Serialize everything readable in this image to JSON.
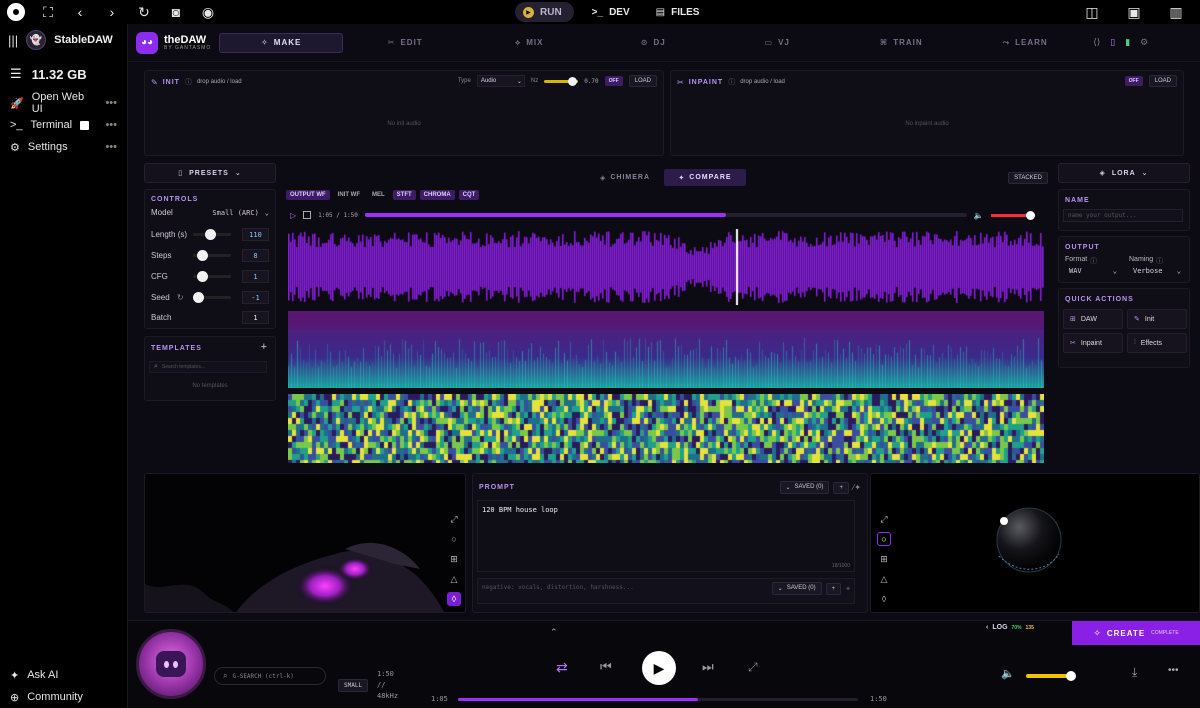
{
  "topbar": {
    "run": "RUN",
    "dev": "DEV",
    "files": "FILES"
  },
  "sidebar": {
    "title": "StableDAW",
    "disk": "11.32 GB",
    "items": [
      {
        "label": "Open Web UI",
        "icon": "rocket-icon"
      },
      {
        "label": "Terminal",
        "icon": "terminal-icon"
      },
      {
        "label": "Settings",
        "icon": "gear-icon"
      }
    ],
    "ask": "Ask AI",
    "community": "Community"
  },
  "app": {
    "logo": "theDAW",
    "logo_sub": "BY GANTASMO",
    "tabs": [
      "MAKE",
      "EDIT",
      "MIX",
      "DJ",
      "VJ",
      "TRAIN",
      "LEARN"
    ]
  },
  "init": {
    "title": "INIT",
    "hint": "drop audio / load",
    "type_label": "Type",
    "type_value": "Audio",
    "nz_label": "Nz",
    "nz_value": "0.70",
    "off": "OFF",
    "load": "LOAD",
    "empty": "No init audio"
  },
  "inpaint": {
    "title": "INPAINT",
    "hint": "drop audio / load",
    "off": "OFF",
    "load": "LOAD",
    "empty": "No inpaint audio"
  },
  "presets": "PRESETS",
  "controls": {
    "title": "CONTROLS",
    "model_label": "Model",
    "model_value": "Small (ARC)",
    "length_label": "Length (s)",
    "length": "110",
    "steps_label": "Steps",
    "steps": "8",
    "cfg_label": "CFG",
    "cfg": "1",
    "seed_label": "Seed",
    "seed": "-1",
    "batch_label": "Batch",
    "batch": "1"
  },
  "templates": {
    "title": "TEMPLATES",
    "placeholder": "Search templates...",
    "empty": "No templates"
  },
  "viewer": {
    "chimera": "CHIMERA",
    "compare": "COMPARE",
    "stacked": "STACKED",
    "chips": [
      "OUTPUT WF",
      "INIT WF",
      "MEL",
      "STFT",
      "CHROMA",
      "CQT"
    ],
    "chips_on": [
      true,
      false,
      false,
      true,
      true,
      true
    ],
    "time": "1:05 / 1:50",
    "progress": 0.6,
    "volume": 0.9
  },
  "lora": "LORA",
  "name": {
    "title": "NAME",
    "placeholder": "name your output..."
  },
  "output": {
    "title": "OUTPUT",
    "format_label": "Format",
    "format": "WAV",
    "naming_label": "Naming",
    "naming": "Verbose"
  },
  "quick": {
    "title": "QUICK ACTIONS",
    "items": [
      "DAW",
      "Init",
      "Inpaint",
      "Effects"
    ]
  },
  "prompt": {
    "title": "PROMPT",
    "saved": "SAVED (0)",
    "text": "120 BPM house loop",
    "count": "18/1000",
    "negative": "negative: vocals, distortion, harshness..."
  },
  "bottom": {
    "log": "LOG",
    "create": "CREATE",
    "complete": "COMPLETE",
    "search": "G-SEARCH (ctrl-k)",
    "size": "SMALL",
    "dur": "1:50",
    "sep": "//",
    "rate": "48kHz",
    "cur": "1:05",
    "end": "1:50",
    "progress": 0.6,
    "volume": 0.9,
    "stat1": "70%",
    "stat2": "135"
  },
  "colors": {
    "accent": "#9b30ff",
    "bg": "#0c0a12"
  }
}
